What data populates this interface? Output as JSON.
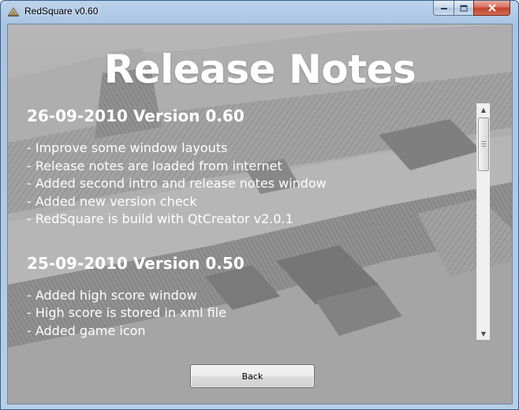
{
  "window": {
    "title": "RedSquare v0.60"
  },
  "heading": "Release Notes",
  "releases": [
    {
      "title": "26-09-2010 Version 0.60",
      "items": [
        "- Improve some window layouts",
        "- Release notes are loaded from internet",
        "- Added second intro and release notes window",
        "- Added new version check",
        "- RedSquare is build with QtCreator v2.0.1"
      ]
    },
    {
      "title": "25-09-2010 Version 0.50",
      "items": [
        "- Added high score window",
        "- High score is stored in xml file",
        "- Added game icon"
      ]
    }
  ],
  "back_button": "Back",
  "icons": {
    "app": "app-icon",
    "minimize": "minimize-icon",
    "maximize": "maximize-icon",
    "close": "close-icon",
    "scroll_up": "scroll-up-arrow-icon",
    "scroll_down": "scroll-down-arrow-icon"
  },
  "colors": {
    "title_bar": "#b8cfe8",
    "close_button": "#c2432b",
    "text": "#ffffff"
  },
  "scroll_position": 0.0
}
